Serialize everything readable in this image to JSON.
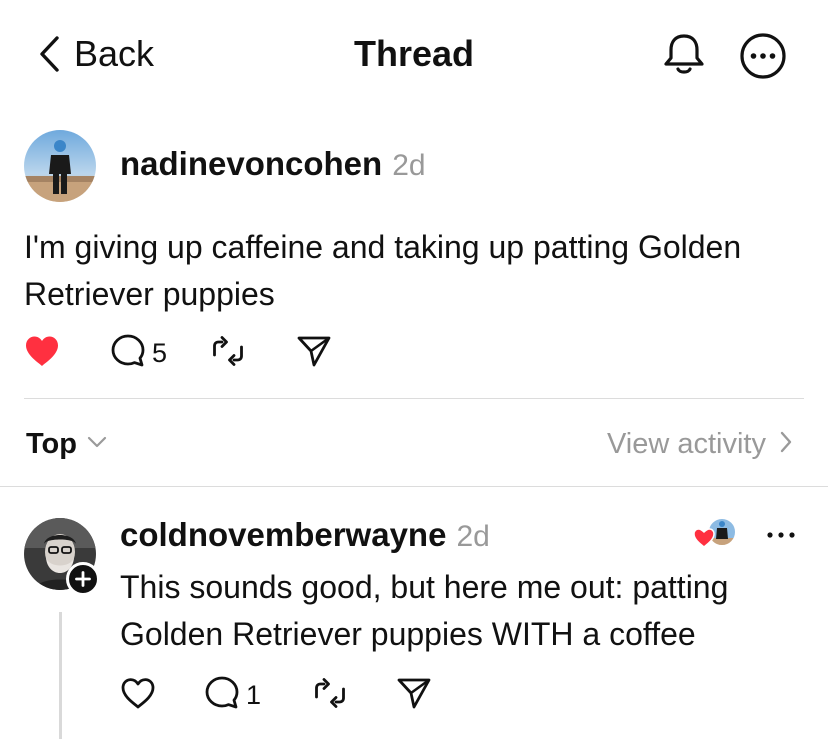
{
  "header": {
    "back_label": "Back",
    "title": "Thread",
    "icons": [
      "chevron-left-icon",
      "bell-icon",
      "more-circle-icon"
    ]
  },
  "post": {
    "username": "nadinevoncohen",
    "time": "2d",
    "text": "I'm giving up caffeine and taking up patting Golden Retriever puppies",
    "liked": true,
    "replies_count": "5",
    "like_color": "#ff3040"
  },
  "sort": {
    "label": "Top",
    "view_activity": "View activity"
  },
  "reply": {
    "username": "coldnovemberwayne",
    "time": "2d",
    "text": "This sounds good, but here me out: patting Golden Retriever puppies WITH a coffee",
    "liked": false,
    "replies_count": "1"
  },
  "colors": {
    "text": "#111111",
    "muted": "#999999",
    "divider": "#dcdcdc",
    "like": "#ff3040"
  }
}
